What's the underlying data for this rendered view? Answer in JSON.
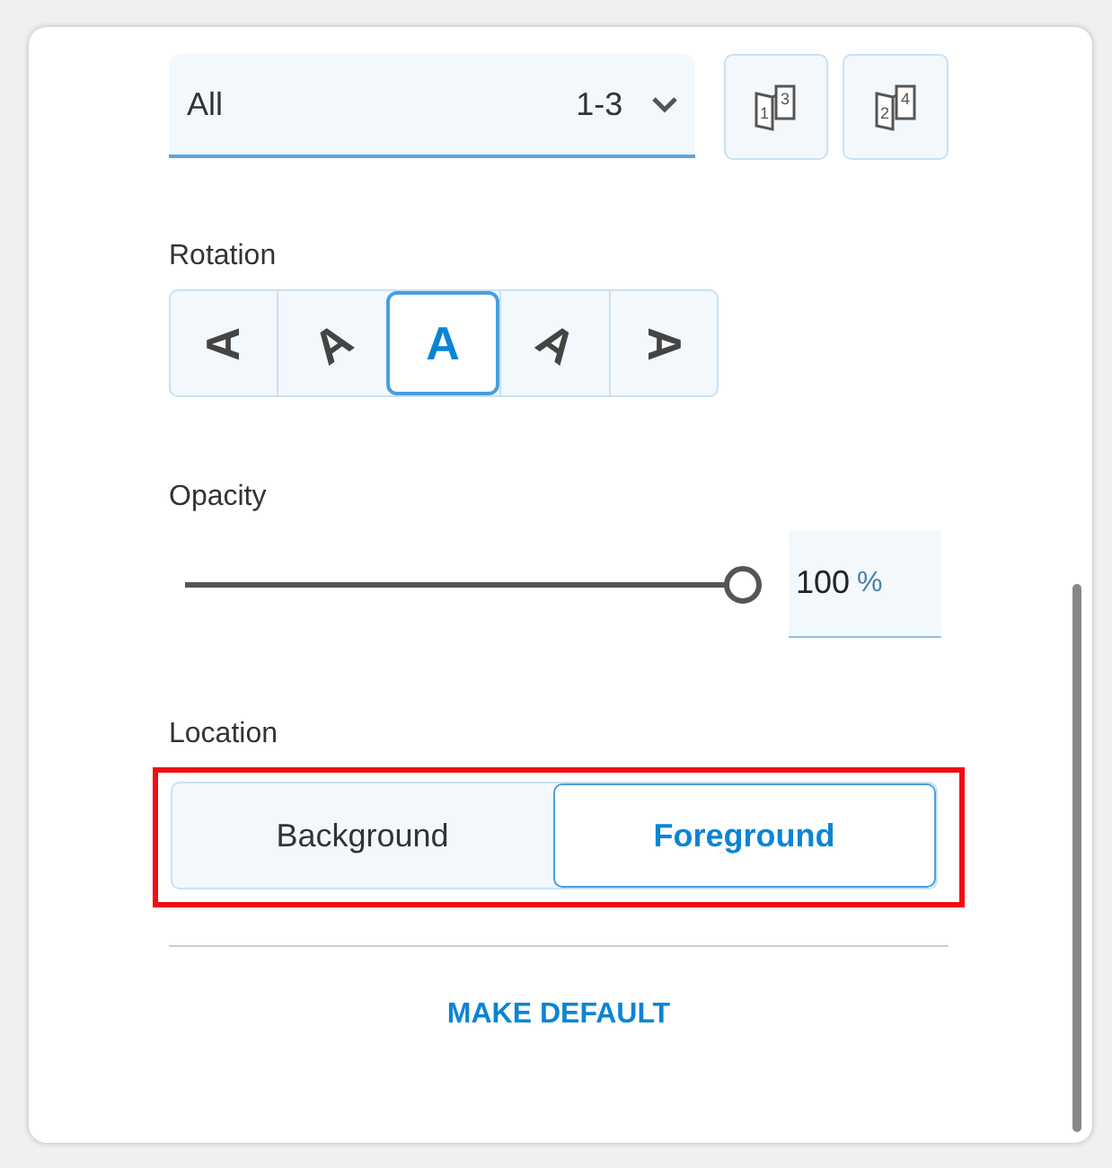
{
  "page_select": {
    "value": "All",
    "range": "1-3",
    "focused": true
  },
  "page_buttons": [
    {
      "digits": [
        "1",
        "3"
      ]
    },
    {
      "digits": [
        "2",
        "4"
      ]
    }
  ],
  "rotation": {
    "label": "Rotation",
    "options": [
      {
        "glyph": "A",
        "kind": "left",
        "selected": false
      },
      {
        "glyph": "A",
        "kind": "up-left",
        "selected": false
      },
      {
        "glyph": "A",
        "kind": "up",
        "selected": true
      },
      {
        "glyph": "A",
        "kind": "up-right",
        "selected": false
      },
      {
        "glyph": "A",
        "kind": "right",
        "selected": false
      }
    ]
  },
  "opacity": {
    "label": "Opacity",
    "level": 1,
    "value": "100",
    "unit": "%"
  },
  "location": {
    "label": "Location",
    "highlighted": true,
    "options": [
      {
        "label": "Background",
        "selected": false
      },
      {
        "label": "Foreground",
        "selected": true
      }
    ]
  },
  "make_default": "MAKE DEFAULT"
}
